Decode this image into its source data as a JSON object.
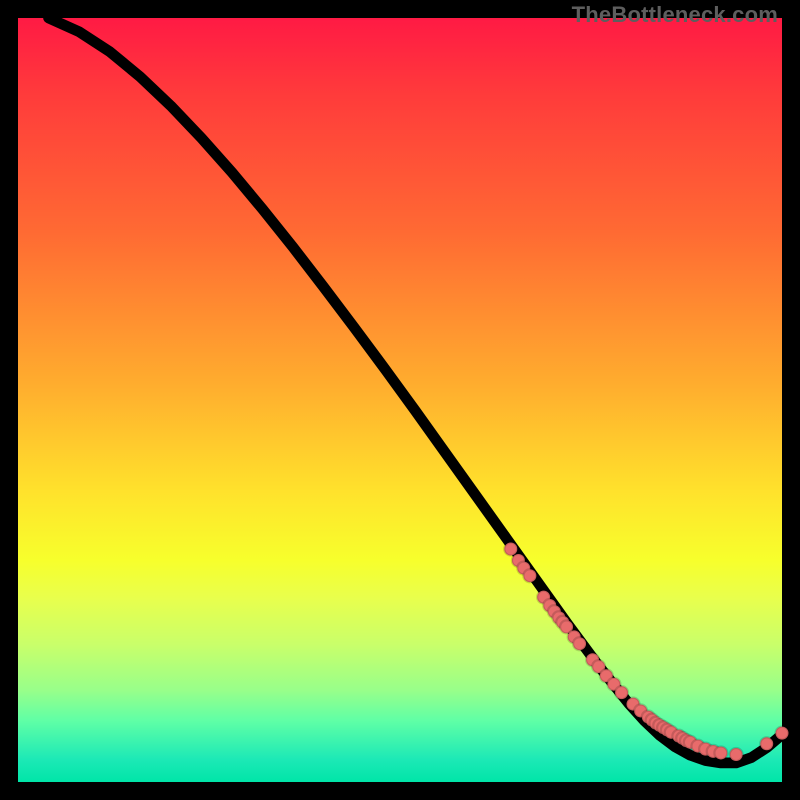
{
  "watermark": "TheBottleneck.com",
  "colors": {
    "point": "#e86b6b",
    "curve": "#000000"
  },
  "chart_data": {
    "type": "line",
    "title": "",
    "xlabel": "",
    "ylabel": "",
    "xlim": [
      0,
      100
    ],
    "ylim": [
      0,
      100
    ],
    "grid": false,
    "legend": false,
    "series": [
      {
        "name": "curve",
        "x": [
          4,
          8,
          12,
          16,
          20,
          24,
          28,
          32,
          36,
          40,
          44,
          48,
          52,
          56,
          60,
          64,
          68,
          72,
          76,
          80,
          82,
          84,
          86,
          88,
          90,
          92,
          94,
          96,
          98,
          100
        ],
        "y": [
          100,
          98.2,
          95.6,
          92.3,
          88.5,
          84.3,
          79.8,
          75.0,
          70.0,
          64.8,
          59.5,
          54.1,
          48.6,
          43.0,
          37.4,
          31.8,
          26.2,
          20.6,
          15.2,
          10.2,
          8.0,
          6.1,
          4.6,
          3.5,
          2.8,
          2.5,
          2.5,
          3.2,
          4.5,
          6.2
        ]
      }
    ],
    "points": {
      "name": "markers",
      "x": [
        64.5,
        65.5,
        66.2,
        67.0,
        68.8,
        69.6,
        70.2,
        70.8,
        71.3,
        71.8,
        72.8,
        73.5,
        75.2,
        76.0,
        77.0,
        78.0,
        79.0,
        80.5,
        81.5,
        82.5,
        83.0,
        83.5,
        84.0,
        84.5,
        85.0,
        85.5,
        86.5,
        87.0,
        87.5,
        88.0,
        89.0,
        90.0,
        91.0,
        92.0,
        94.0,
        98.0,
        100.0
      ],
      "y": [
        30.5,
        29.0,
        28.0,
        27.0,
        24.2,
        23.1,
        22.3,
        21.5,
        20.9,
        20.3,
        19.0,
        18.1,
        16.0,
        15.1,
        13.9,
        12.8,
        11.7,
        10.2,
        9.3,
        8.5,
        8.1,
        7.7,
        7.4,
        7.1,
        6.8,
        6.5,
        6.0,
        5.7,
        5.4,
        5.2,
        4.7,
        4.3,
        4.0,
        3.8,
        3.6,
        5.0,
        6.4
      ]
    }
  }
}
